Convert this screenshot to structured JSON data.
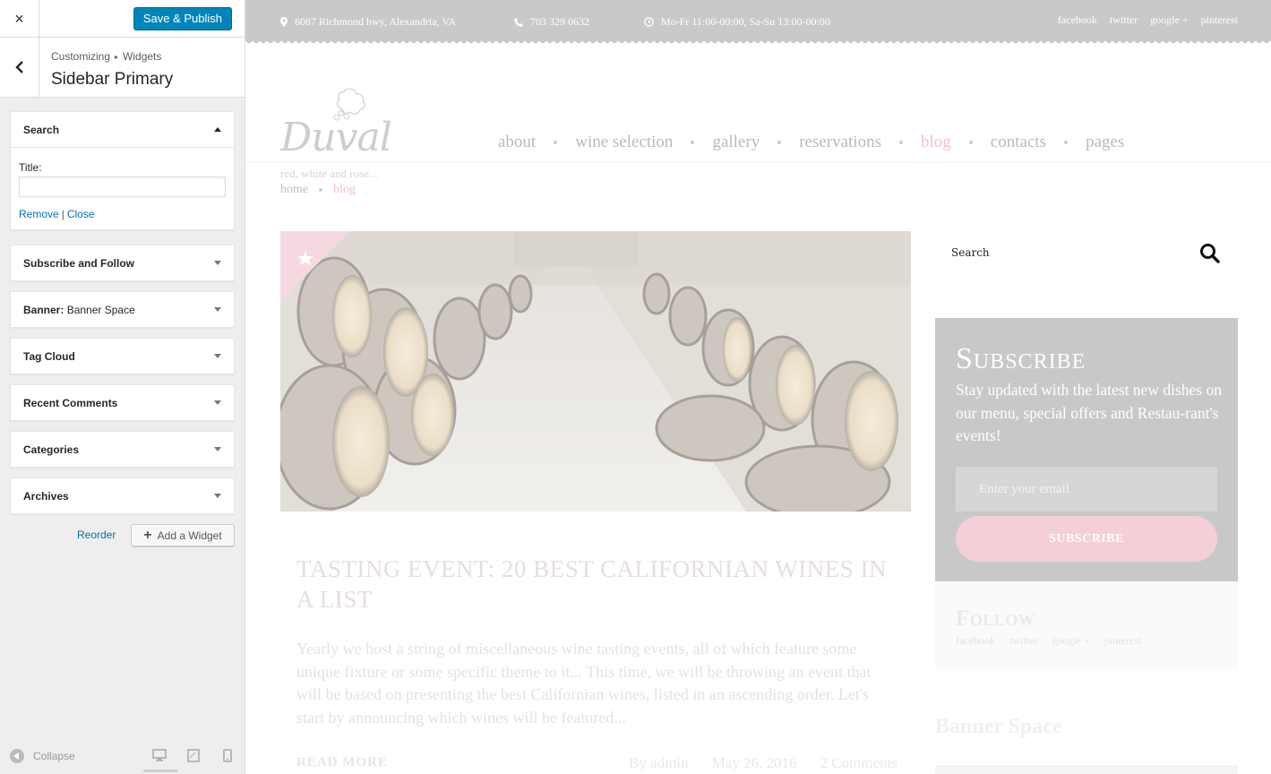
{
  "customizer": {
    "close_label": "×",
    "save_label": "Save & Publish",
    "breadcrumb": {
      "parent": "Customizing",
      "separator": "▸",
      "current": "Widgets"
    },
    "title": "Sidebar Primary",
    "widgets": [
      {
        "title": "Search",
        "subtitle": "",
        "expanded": true
      },
      {
        "title": "Subscribe and Follow",
        "subtitle": "",
        "expanded": false
      },
      {
        "title": "Banner:",
        "subtitle": "Banner Space",
        "expanded": false
      },
      {
        "title": "Tag Cloud",
        "subtitle": "",
        "expanded": false
      },
      {
        "title": "Recent Comments",
        "subtitle": "",
        "expanded": false
      },
      {
        "title": "Categories",
        "subtitle": "",
        "expanded": false
      },
      {
        "title": "Archives",
        "subtitle": "",
        "expanded": false
      }
    ],
    "search_widget": {
      "field_label": "Title:",
      "field_value": "",
      "remove_label": "Remove",
      "pipe": "|",
      "close_label": "Close"
    },
    "reorder_label": "Reorder",
    "add_widget_label": "Add a Widget",
    "collapse_label": "Collapse",
    "devices": [
      "desktop-icon",
      "tablet-icon",
      "mobile-icon"
    ],
    "accent_color": "#0085ba"
  },
  "preview": {
    "topbar": {
      "address": "6087 Richmond hwy, Alexandria, VA",
      "phone": "703 329 0632",
      "hours": "Mo-Fr 11:00-00:00, Sa-Su 13:00-00:00",
      "social": [
        "facebook",
        "twitter",
        "google +",
        "pinterest"
      ]
    },
    "logo": {
      "name": "Duval",
      "tagline": "red, white and rose..."
    },
    "nav": [
      {
        "label": "about",
        "active": false
      },
      {
        "label": "wine selection",
        "active": false
      },
      {
        "label": "gallery",
        "active": false
      },
      {
        "label": "reservations",
        "active": false
      },
      {
        "label": "blog",
        "active": true
      },
      {
        "label": "contacts",
        "active": false
      },
      {
        "label": "pages",
        "active": false
      }
    ],
    "breadcrumbs": [
      "home",
      "blog"
    ],
    "post": {
      "title": "TASTING EVENT: 20 BEST CALIFORNIAN WINES IN A LIST",
      "excerpt": "Yearly we host a string of miscellaneous wine tasting events, all of which feature some unique fixture or some specific theme to it... This time, we will be throwing an event that will be based on presenting the best Californian wines, listed in an ascending order. Let's start by announcing which wines will be featured...",
      "read_more": "READ MORE",
      "author": "By admin",
      "date": "May 26, 2016",
      "comments": "2 Comments"
    },
    "sidebar": {
      "search_placeholder": "Search",
      "subscribe": {
        "title": "Subscribe",
        "text": "Stay updated with the latest new dishes on our menu, special offers and Restau-rant's events!",
        "email_placeholder": "Enter your email",
        "button": "SUBSCRIBE"
      },
      "follow": {
        "title": "Follow",
        "links": [
          "facebook",
          "twitter",
          "google +",
          "pinterest"
        ]
      },
      "banner_title": "Banner Space"
    },
    "accent_color": "#f2c0cd"
  }
}
